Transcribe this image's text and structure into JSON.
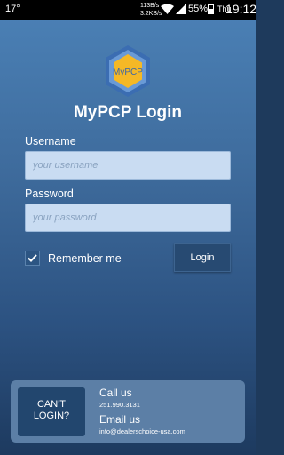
{
  "status_bar": {
    "temperature": "17°",
    "net_up": "113B/s",
    "net_down": "3.2KB/s",
    "battery": "55%",
    "day": "Thu",
    "time": "19:12"
  },
  "logo": {
    "text": "MyPCP"
  },
  "title": "MyPCP Login",
  "username": {
    "label": "Username",
    "placeholder": "your username",
    "value": ""
  },
  "password": {
    "label": "Password",
    "placeholder": "your password",
    "value": ""
  },
  "remember_me": {
    "label": "Remember me",
    "checked": true
  },
  "login_button": "Login",
  "cant_login": {
    "line1": "CAN'T",
    "line2": "LOGIN?"
  },
  "contact": {
    "call_label": "Call us",
    "phone": "251.990.3131",
    "email_label": "Email us",
    "email": "info@dealerschoice-usa.com"
  }
}
